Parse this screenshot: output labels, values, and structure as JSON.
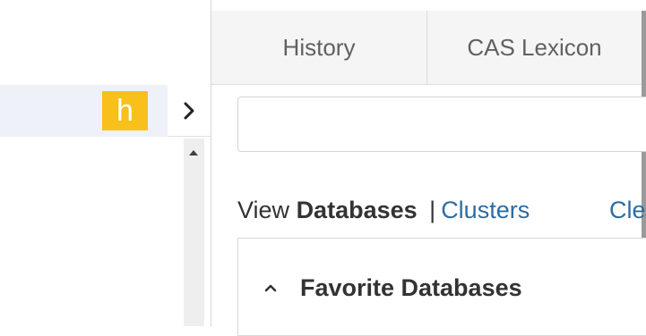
{
  "sidebar": {
    "badge_letter": "h",
    "badge_color": "#f7c01b",
    "toggle_icon": "chevron-right-icon",
    "scroll_icon": "scroll-up-arrow-icon"
  },
  "tabs": [
    {
      "label": "History"
    },
    {
      "label": "CAS Lexicon"
    }
  ],
  "search": {
    "value": "",
    "placeholder": ""
  },
  "view": {
    "prefix": "View",
    "databases": "Databases",
    "separator": "|",
    "clusters": "Clusters",
    "clear": "Cle"
  },
  "favorites": {
    "title": "Favorite Databases",
    "icon": "chevron-up-icon"
  },
  "colors": {
    "accent_link": "#2d6ca2",
    "tab_bg": "#f5f5f5"
  }
}
